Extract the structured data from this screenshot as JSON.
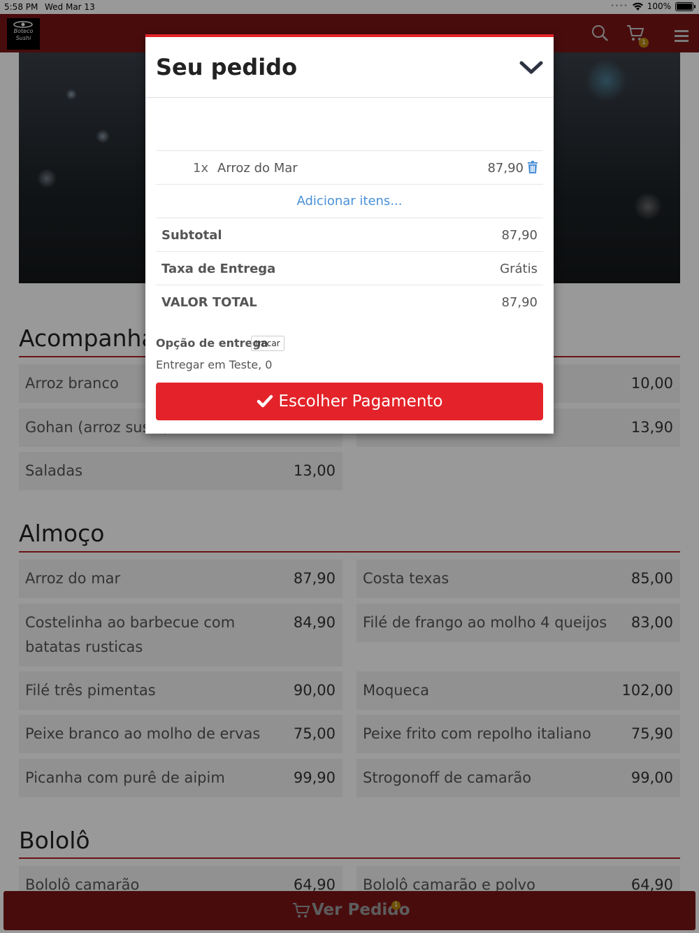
{
  "status_bar": {
    "time": "5:58 PM",
    "date": "Wed Mar 13",
    "battery": "100%"
  },
  "header": {
    "logo_text": "Boteco Sushi",
    "cart_count": "1"
  },
  "sections": [
    {
      "title": "Acompanhamentos",
      "items": [
        {
          "name": "Arroz branco",
          "price": ""
        },
        {
          "name": "",
          "price": "10,00"
        },
        {
          "name": "Gohan (arroz sushi)",
          "price": ""
        },
        {
          "name": "",
          "price": "13,90"
        },
        {
          "name": "Saladas",
          "price": "13,00"
        }
      ]
    },
    {
      "title": "Almoço",
      "items": [
        {
          "name": "Arroz do mar",
          "price": "87,90"
        },
        {
          "name": "Costa texas",
          "price": "85,00"
        },
        {
          "name": "Costelinha ao barbecue com batatas rusticas",
          "price": "84,90"
        },
        {
          "name": "Filé de frango ao molho 4 queijos",
          "price": "83,00"
        },
        {
          "name": "Filé três pimentas",
          "price": "90,00"
        },
        {
          "name": "Moqueca",
          "price": "102,00"
        },
        {
          "name": "Peixe branco ao molho de ervas",
          "price": "75,00"
        },
        {
          "name": "Peixe frito com repolho italiano",
          "price": "75,90"
        },
        {
          "name": "Picanha com purê de aipim",
          "price": "99,90"
        },
        {
          "name": "Strogonoff de camarão",
          "price": "99,00"
        }
      ]
    },
    {
      "title": "Bololô",
      "items": [
        {
          "name": "Bololô camarão",
          "price": "64,90"
        },
        {
          "name": "Bololô camarão e polvo",
          "price": "64,90"
        }
      ]
    }
  ],
  "modal": {
    "title": "Seu pedido",
    "order_items": [
      {
        "qty": "1x",
        "name": "Arroz do Mar",
        "price": "87,90"
      }
    ],
    "add_items_label": "Adicionar itens...",
    "subtotal_label": "Subtotal",
    "subtotal_value": "87,90",
    "delivery_fee_label": "Taxa de Entrega",
    "delivery_fee_value": "Grátis",
    "total_label": "VALOR TOTAL",
    "total_value": "87,90",
    "delivery_option_label": "Opção de entrega",
    "swap_label": "trocar",
    "delivery_address": "Entregar em Teste, 0",
    "pay_button_label": "Escolher Pagamento"
  },
  "bottom_bar": {
    "label": "Ver Pedido",
    "badge": "1"
  },
  "colors": {
    "brand": "#7b1416",
    "accent": "#e32329",
    "link": "#4a90d9"
  }
}
